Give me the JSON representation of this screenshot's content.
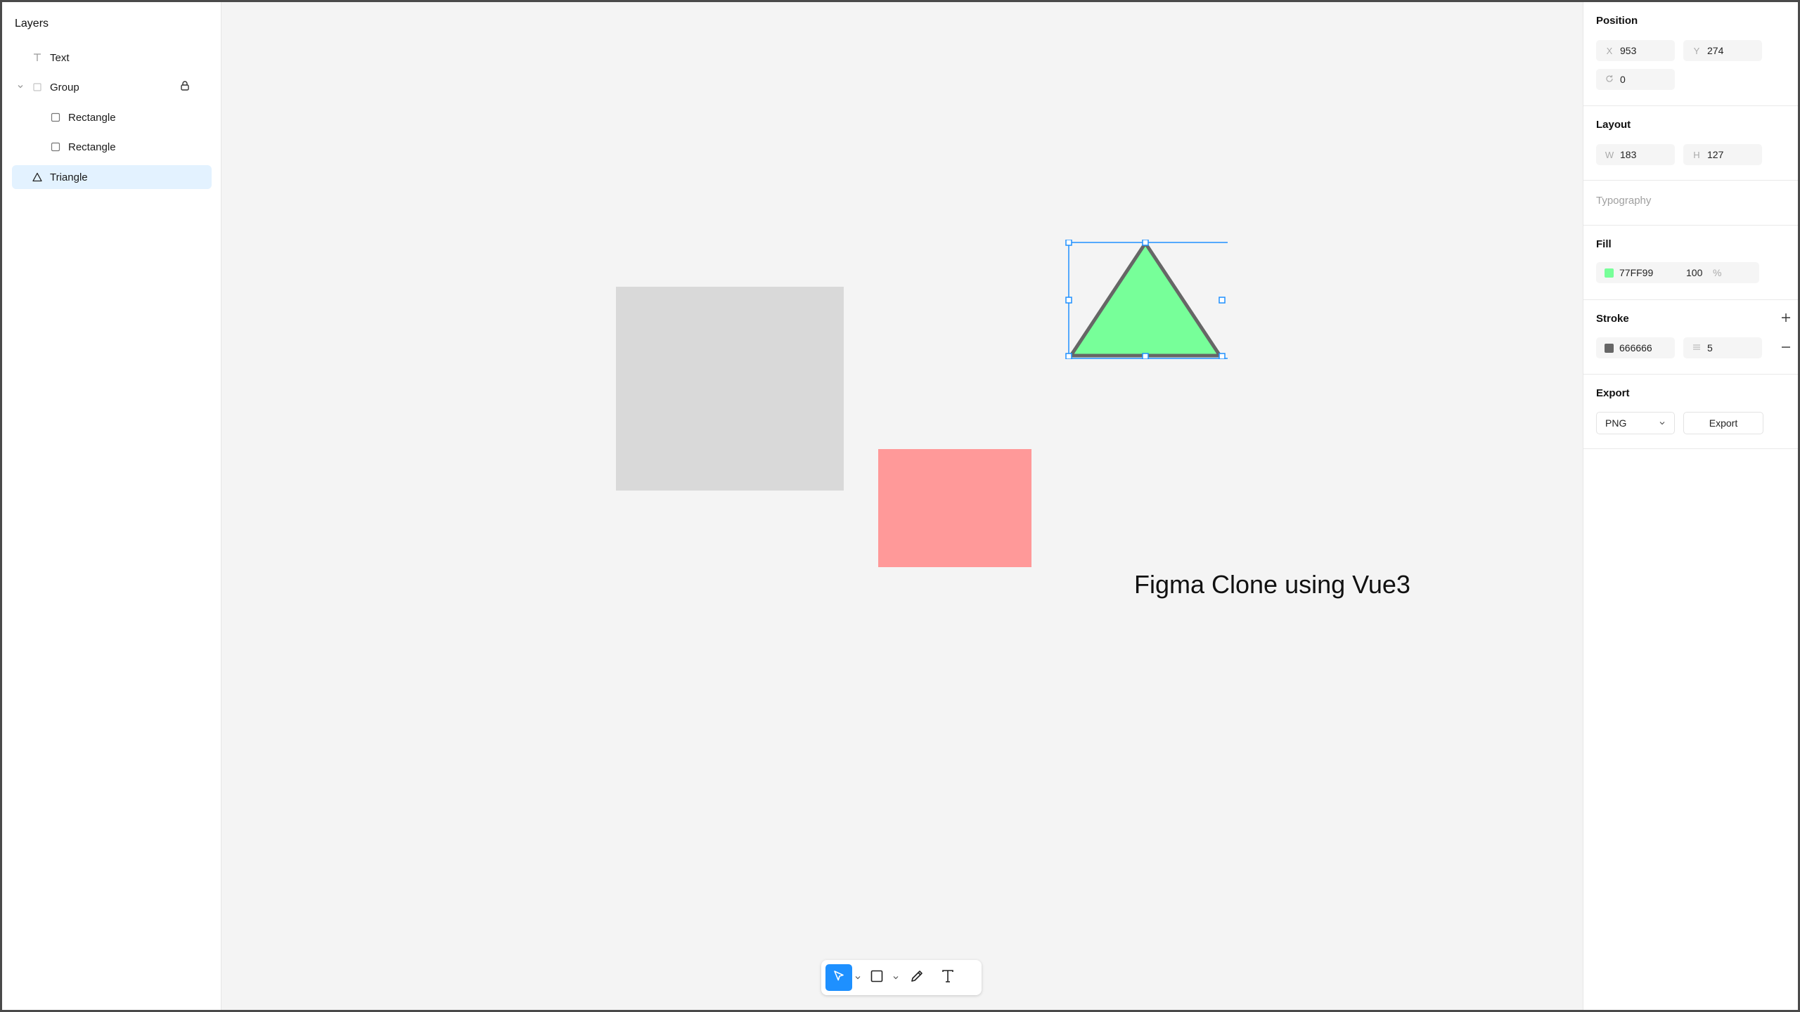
{
  "layers_panel": {
    "title": "Layers",
    "items": [
      {
        "label": "Text",
        "icon": "text-icon"
      },
      {
        "label": "Group",
        "icon": "frame-icon",
        "locked": true,
        "expanded": true
      },
      {
        "label": "Rectangle",
        "icon": "square-icon"
      },
      {
        "label": "Rectangle",
        "icon": "square-icon"
      },
      {
        "label": "Triangle",
        "icon": "triangle-icon",
        "selected": true
      }
    ]
  },
  "canvas": {
    "text_layer": "Figma Clone using Vue3",
    "colors": {
      "gray_rect": "#D9D9D9",
      "pink_rect": "#FF9999",
      "triangle_fill": "#77FF99",
      "triangle_stroke": "#666666",
      "selection": "#1E90FF"
    }
  },
  "toolbar": {
    "tools": [
      "select-icon",
      "rectangle-icon",
      "pen-icon",
      "text-tool-icon"
    ],
    "active": "select"
  },
  "properties": {
    "position": {
      "title": "Position",
      "x_label": "X",
      "x": "953",
      "y_label": "Y",
      "y": "274",
      "rotation": "0"
    },
    "layout": {
      "title": "Layout",
      "w_label": "W",
      "w": "183",
      "h_label": "H",
      "h": "127"
    },
    "typography": {
      "title": "Typography"
    },
    "fill": {
      "title": "Fill",
      "color": "77FF99",
      "opacity": "100",
      "opacity_unit": "%"
    },
    "stroke": {
      "title": "Stroke",
      "color": "666666",
      "width": "5"
    },
    "export": {
      "title": "Export",
      "format": "PNG",
      "button": "Export"
    }
  }
}
